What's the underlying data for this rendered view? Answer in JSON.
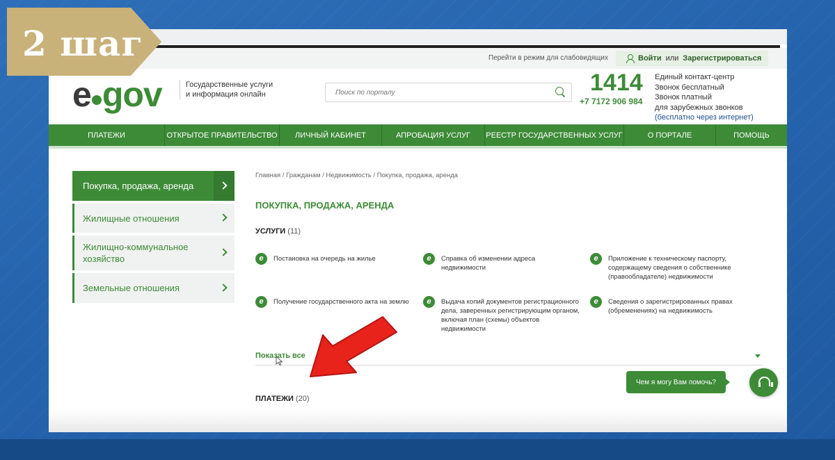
{
  "step_badge": {
    "text": "2 шаг"
  },
  "topbar": {
    "vision_mode": "Перейти в режим для слабовидящих",
    "login": "Войти",
    "or": "или",
    "register": "Зарегистрироваться"
  },
  "header": {
    "logo_e": "e",
    "logo_gov": "gov",
    "tagline_line1": "Государственные услуги",
    "tagline_line2": "и информация онлайн",
    "search_placeholder": "Поиск по порталу",
    "phone_short": "1414",
    "phone_full": "+7 7172 906 984",
    "contact_line1": "Единый контакт-центр",
    "contact_line2": "Звонок бесплатный",
    "contact_line3": "Звонок платный",
    "contact_line4": "для зарубежных звонков",
    "contact_line5": "(бесплатно через интернет)"
  },
  "nav": {
    "items": [
      {
        "label": "ПЛАТЕЖИ"
      },
      {
        "label": "ОТКРЫТОЕ ПРАВИТЕЛЬСТВО"
      },
      {
        "label": "ЛИЧНЫЙ КАБИНЕТ"
      },
      {
        "label": "АПРОБАЦИЯ УСЛУГ"
      },
      {
        "label": "РЕЕСТР ГОСУДАРСТВЕННЫХ УСЛУГ"
      },
      {
        "label": "О ПОРТАЛЕ"
      },
      {
        "label": "ПОМОЩЬ"
      }
    ]
  },
  "sidebar": {
    "items": [
      {
        "label": "Покупка, продажа, аренда",
        "active": true
      },
      {
        "label": "Жилищные отношения"
      },
      {
        "label": "Жилищно-коммунальное хозяйство"
      },
      {
        "label": "Земельные отношения"
      }
    ]
  },
  "main": {
    "breadcrumb": "Главная / Гражданам / Недвижимость / Покупка, продажа, аренда",
    "title": "ПОКУПКА, ПРОДАЖА, АРЕНДА",
    "services_label": "УСЛУГИ",
    "services_count": "(11)",
    "services": [
      {
        "text": "Постановка на очередь на жилье"
      },
      {
        "text": "Справка об изменении адреса недвижимости"
      },
      {
        "text": "Приложение к техническому паспорту, содержащему сведения о собственнике (правообладателе) недвижимости"
      },
      {
        "text": "Получение государственного акта на землю"
      },
      {
        "text": "Выдача копий документов регистрационного дела, заверенных регистрирующим органом, включая план (схемы) объектов недвижимости"
      },
      {
        "text": "Сведения о зарегистрированных правах (обременениях) на недвижимость"
      }
    ],
    "show_all": "Показать все",
    "payments_label": "ПЛАТЕЖИ",
    "payments_count": "(20)"
  },
  "help": {
    "bubble": "Чем я могу Вам помочь?"
  },
  "colors": {
    "brand_green": "#3d8b37",
    "badge_gold": "#c9b17a",
    "background_blue": "#2563ad",
    "arrow_red": "#e8231c"
  },
  "icons": [
    "person-icon",
    "search-icon",
    "chevron-right-icon",
    "e-service-icon",
    "caret-down-icon",
    "headset-icon",
    "red-arrow-icon",
    "mouse-cursor-icon"
  ]
}
